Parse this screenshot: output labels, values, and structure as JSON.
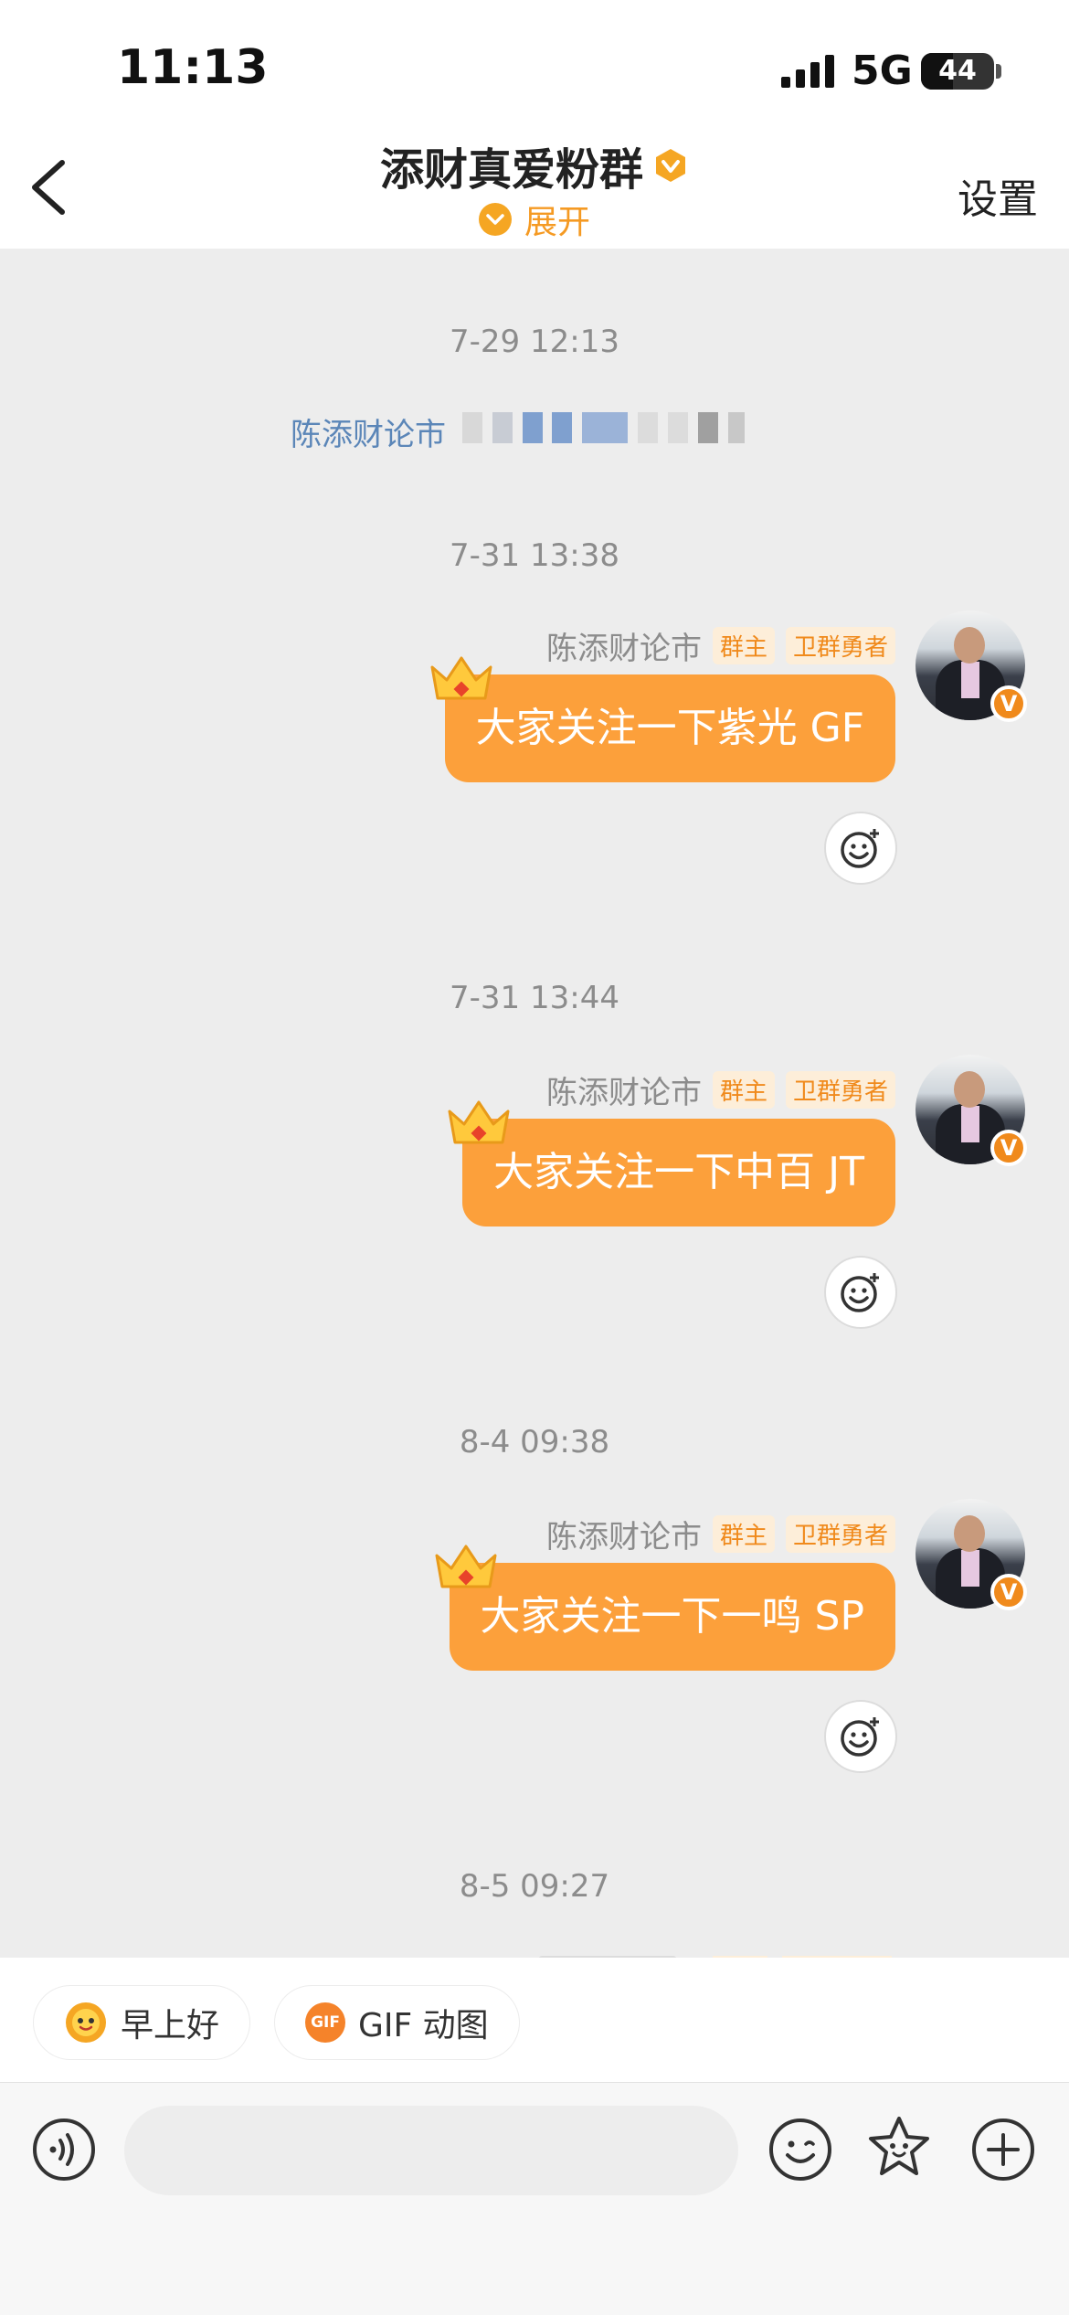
{
  "status_bar": {
    "time": "11:13",
    "network": "5G",
    "battery": "44",
    "battery_level": 0.44
  },
  "nav": {
    "title": "添财真爱粉群",
    "expand_label": "展开",
    "settings_label": "设置"
  },
  "system_message": {
    "timestamp": "7-29 12:13",
    "sender": "陈添财论市"
  },
  "messages": [
    {
      "timestamp": "7-31 13:38",
      "sender": "陈添财论市",
      "tags": [
        "群主",
        "卫群勇者"
      ],
      "text": "大家关注一下紫光 GF"
    },
    {
      "timestamp": "7-31 13:44",
      "sender": "陈添财论市",
      "tags": [
        "群主",
        "卫群勇者"
      ],
      "text": "大家关注一下中百 JT"
    },
    {
      "timestamp": "8-4 09:38",
      "sender": "陈添财论市",
      "tags": [
        "群主",
        "卫群勇者"
      ],
      "text": "大家关注一下一鸣 SP"
    }
  ],
  "partial_message": {
    "timestamp": "8-5 09:27"
  },
  "quick_replies": [
    {
      "label": "早上好",
      "icon": "sun-face-icon"
    },
    {
      "label": "GIF 动图",
      "icon": "gif-icon",
      "icon_text": "GIF"
    }
  ],
  "input": {
    "placeholder": ""
  },
  "colors": {
    "accent": "#f5a623",
    "bubble": "#fca03b",
    "chat_bg": "#ededed"
  }
}
